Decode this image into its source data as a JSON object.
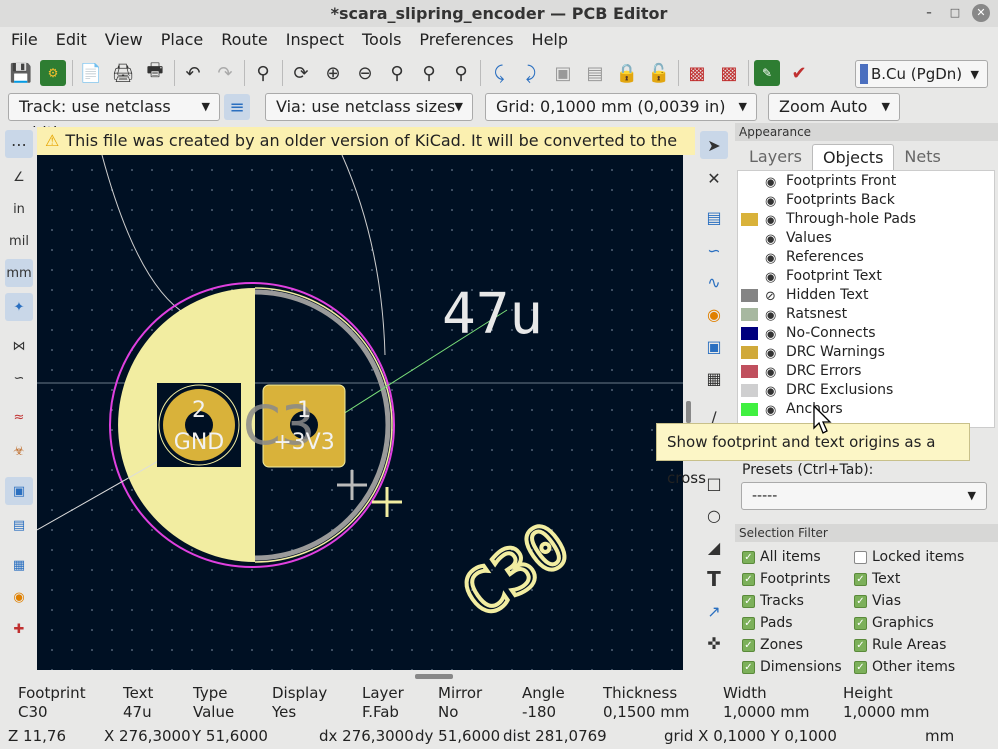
{
  "window": {
    "title": "*scara_slipring_encoder — PCB Editor"
  },
  "menu": [
    "File",
    "Edit",
    "View",
    "Place",
    "Route",
    "Inspect",
    "Tools",
    "Preferences",
    "Help"
  ],
  "toolbar": {
    "layer": "B.Cu (PgDn)",
    "layer_color": "#4b6fbf"
  },
  "toolbar2": {
    "track": "Track: use netclass width",
    "via": "Via: use netclass sizes",
    "grid": "Grid: 0,1000 mm (0,0039 in)",
    "zoom": "Zoom Auto"
  },
  "left_toolbar": {
    "inch": "in",
    "mil": "mil",
    "mm": "mm"
  },
  "infobar": {
    "message": "This file was created by an older version of KiCad. It will be converted to the new"
  },
  "board": {
    "value_text": "47u",
    "ref_text": "C30",
    "pad1": {
      "number": "1",
      "net": "+3V3"
    },
    "pad2": {
      "number": "2",
      "net": "GND"
    },
    "ghost_ref": "C3",
    "colors": {
      "background": "#001023",
      "silk": "#f2eda1",
      "pad": "#d9b23a",
      "courtyard": "#e040e0",
      "ratsnest": "#c8f0c8"
    }
  },
  "appearance": {
    "header": "Appearance",
    "tabs": [
      "Layers",
      "Objects",
      "Nets"
    ],
    "active_tab": "Objects",
    "objects": [
      {
        "name": "Footprints Front",
        "color": "",
        "visible": true
      },
      {
        "name": "Footprints Back",
        "color": "",
        "visible": true
      },
      {
        "name": "Through-hole Pads",
        "color": "#d9b23a",
        "visible": true
      },
      {
        "name": "Values",
        "color": "",
        "visible": true
      },
      {
        "name": "References",
        "color": "",
        "visible": true
      },
      {
        "name": "Footprint Text",
        "color": "",
        "visible": true
      },
      {
        "name": "Hidden Text",
        "color": "#848484",
        "visible": false
      },
      {
        "name": "Ratsnest",
        "color": "#a7b8a0",
        "visible": true
      },
      {
        "name": "No-Connects",
        "color": "#00007e",
        "visible": true
      },
      {
        "name": "DRC Warnings",
        "color": "#d0a93a",
        "visible": true
      },
      {
        "name": "DRC Errors",
        "color": "#c0505e",
        "visible": true
      },
      {
        "name": "DRC Exclusions",
        "color": "#cfcfd0",
        "visible": true
      },
      {
        "name": "Anchors",
        "color": "#40f040",
        "visible": true
      }
    ],
    "tooltip": "Show footprint and text origins as a cross",
    "presets_label": "Presets (Ctrl+Tab):",
    "presets_value": "-----"
  },
  "selection_filter": {
    "header": "Selection Filter",
    "items": [
      {
        "label": "All items",
        "checked": true
      },
      {
        "label": "Locked items",
        "checked": false
      },
      {
        "label": "Footprints",
        "checked": true
      },
      {
        "label": "Text",
        "checked": true
      },
      {
        "label": "Tracks",
        "checked": true
      },
      {
        "label": "Vias",
        "checked": true
      },
      {
        "label": "Pads",
        "checked": true
      },
      {
        "label": "Graphics",
        "checked": true
      },
      {
        "label": "Zones",
        "checked": true
      },
      {
        "label": "Rule Areas",
        "checked": true
      },
      {
        "label": "Dimensions",
        "checked": true
      },
      {
        "label": "Other items",
        "checked": true
      }
    ]
  },
  "message_panel": [
    {
      "label": "Footprint",
      "value": "C30"
    },
    {
      "label": "Text",
      "value": "47u"
    },
    {
      "label": "Type",
      "value": "Value"
    },
    {
      "label": "Display",
      "value": "Yes"
    },
    {
      "label": "Layer",
      "value": "F.Fab"
    },
    {
      "label": "Mirror",
      "value": "No"
    },
    {
      "label": "Angle",
      "value": "-180"
    },
    {
      "label": "Thickness",
      "value": "0,1500 mm"
    },
    {
      "label": "Width",
      "value": "1,0000 mm"
    },
    {
      "label": "Height",
      "value": "1,0000 mm"
    }
  ],
  "status": {
    "z": "Z 11,76",
    "x": "X 276,3000",
    "y": "Y 51,6000",
    "dx": "dx 276,3000",
    "dy": "dy 51,6000",
    "dist": "dist 281,0769",
    "grid": "grid X 0,1000  Y 0,1000",
    "units": "mm"
  }
}
